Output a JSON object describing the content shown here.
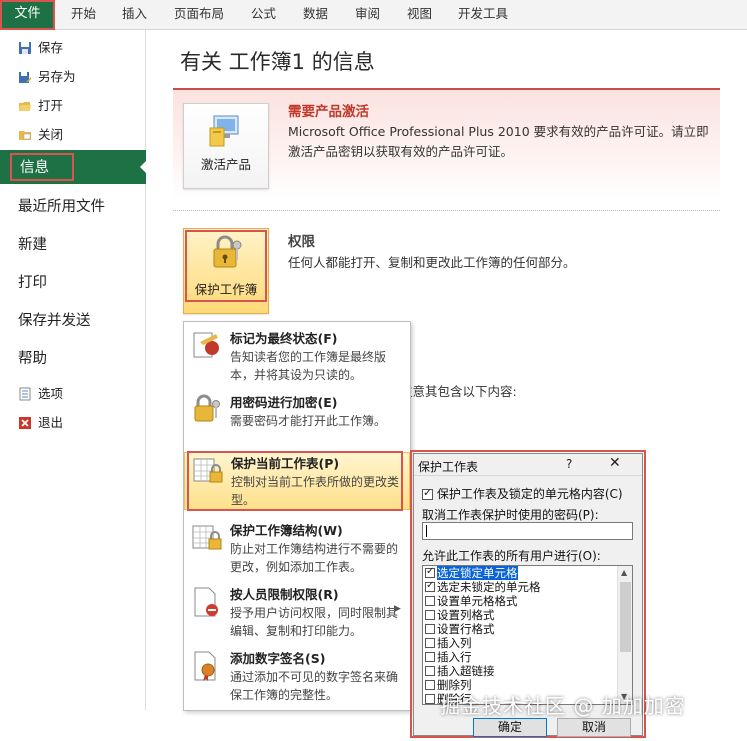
{
  "ribbon": {
    "file_tab": "文件",
    "tabs": [
      "开始",
      "插入",
      "页面布局",
      "公式",
      "数据",
      "审阅",
      "视图",
      "开发工具"
    ]
  },
  "nav": {
    "save": "保存",
    "save_as": "另存为",
    "open": "打开",
    "close": "关闭",
    "info": "信息",
    "recent": "最近所用文件",
    "new": "新建",
    "print": "打印",
    "save_send": "保存并发送",
    "help": "帮助",
    "options": "选项",
    "exit": "退出"
  },
  "main": {
    "title": "有关 工作簿1 的信息",
    "activation": {
      "button": "激活产品",
      "title": "需要产品激活",
      "body": "Microsoft Office Professional Plus 2010 要求有效的产品许可证。请立即激活产品密钥以获取有效的产品许可证。"
    },
    "permissions": {
      "button": "保护工作簿",
      "title": "权限",
      "body": "任何人都能打开、复制和更改此工作簿的任何部分。"
    },
    "behind_text": "注意其包含以下内容:"
  },
  "menu": {
    "items": [
      {
        "title": "标记为最终状态(F)",
        "desc": "告知读者您的工作簿是最终版本，并将其设为只读的。"
      },
      {
        "title": "用密码进行加密(E)",
        "desc": "需要密码才能打开此工作簿。"
      },
      {
        "title": "保护当前工作表(P)",
        "desc": "控制对当前工作表所做的更改类型。"
      },
      {
        "title": "保护工作簿结构(W)",
        "desc": "防止对工作簿结构进行不需要的更改，例如添加工作表。"
      },
      {
        "title": "按人员限制权限(R)",
        "desc": "授予用户访问权限，同时限制其编辑、复制和打印能力。"
      },
      {
        "title": "添加数字签名(S)",
        "desc": "通过添加不可见的数字签名来确保工作簿的完整性。"
      }
    ]
  },
  "dialog": {
    "title": "保护工作表",
    "help": "?",
    "close": "✕",
    "protect_label": "保护工作表及锁定的单元格内容(C)",
    "protect_checked": true,
    "password_label": "取消工作表保护时使用的密码(P):",
    "password_value": "",
    "allow_label": "允许此工作表的所有用户进行(O):",
    "allow_items": [
      {
        "label": "选定锁定单元格",
        "checked": true,
        "selected": true
      },
      {
        "label": "选定未锁定的单元格",
        "checked": true,
        "selected": false
      },
      {
        "label": "设置单元格格式",
        "checked": false,
        "selected": false
      },
      {
        "label": "设置列格式",
        "checked": false,
        "selected": false
      },
      {
        "label": "设置行格式",
        "checked": false,
        "selected": false
      },
      {
        "label": "插入列",
        "checked": false,
        "selected": false
      },
      {
        "label": "插入行",
        "checked": false,
        "selected": false
      },
      {
        "label": "插入超链接",
        "checked": false,
        "selected": false
      },
      {
        "label": "删除列",
        "checked": false,
        "selected": false
      },
      {
        "label": "删除行",
        "checked": false,
        "selected": false
      }
    ],
    "ok": "确定",
    "cancel": "取消"
  },
  "watermark": "掘金技术社区 @ 加加加密",
  "colors": {
    "file_green": "#1e7145",
    "highlight_red": "#d9534f",
    "activation_red": "#c0392b"
  }
}
